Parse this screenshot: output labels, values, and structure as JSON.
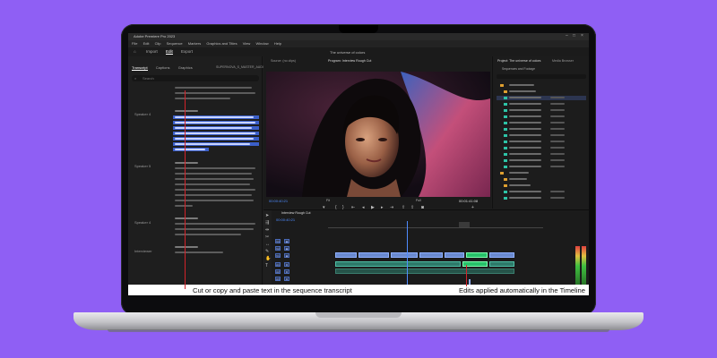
{
  "app": {
    "window_title": "Adobe Premiere Pro 2023",
    "menu": [
      "File",
      "Edit",
      "Clip",
      "Sequence",
      "Markers",
      "Graphics and Titles",
      "View",
      "Window",
      "Help"
    ],
    "workspace_tabs": [
      "Import",
      "Edit",
      "Export"
    ],
    "active_workspace": "Edit",
    "project_name": "The universe of colors"
  },
  "transcript_panel": {
    "tabs": [
      "Transcript",
      "Captions",
      "Graphics"
    ],
    "active_tab": "Transcript",
    "sequence_name": "SUPERNOVA_S_MASTER_AUDIO",
    "search_placeholder": "Search",
    "speakers": [
      "Speaker 4",
      "Speaker 5",
      "Speaker 4",
      "Interviewer"
    ],
    "footer_label": "Calibrate ahead of transcribing"
  },
  "monitor": {
    "source_tab": "Source: (no clips)",
    "program_tab": "Program: Interview Rough Cut",
    "timecode_left": "00:00:40:21",
    "timecode_right": "00:01:41:08",
    "zoom": "Fit",
    "quality": "Full"
  },
  "project_panel": {
    "title": "Project: The universe of colors",
    "tab2": "Media Browser",
    "items_label": "Sequences and Footage"
  },
  "timeline": {
    "tab": "Interview Rough Cut",
    "timecode": "00:00:40:21",
    "tracks_video": [
      "V3",
      "V2",
      "V1"
    ],
    "tracks_audio": [
      "A1",
      "A2",
      "A3"
    ]
  },
  "callouts": {
    "left": "Cut or copy and paste text in the sequence transcript",
    "right": "Edits applied automatically in the Timeline",
    "accent": "#d2232a"
  },
  "colors": {
    "background": "#8f5ff4",
    "highlight": "#3b5fc8",
    "media_icon": "#2dc3a6",
    "folder_icon": "#e0a030"
  }
}
